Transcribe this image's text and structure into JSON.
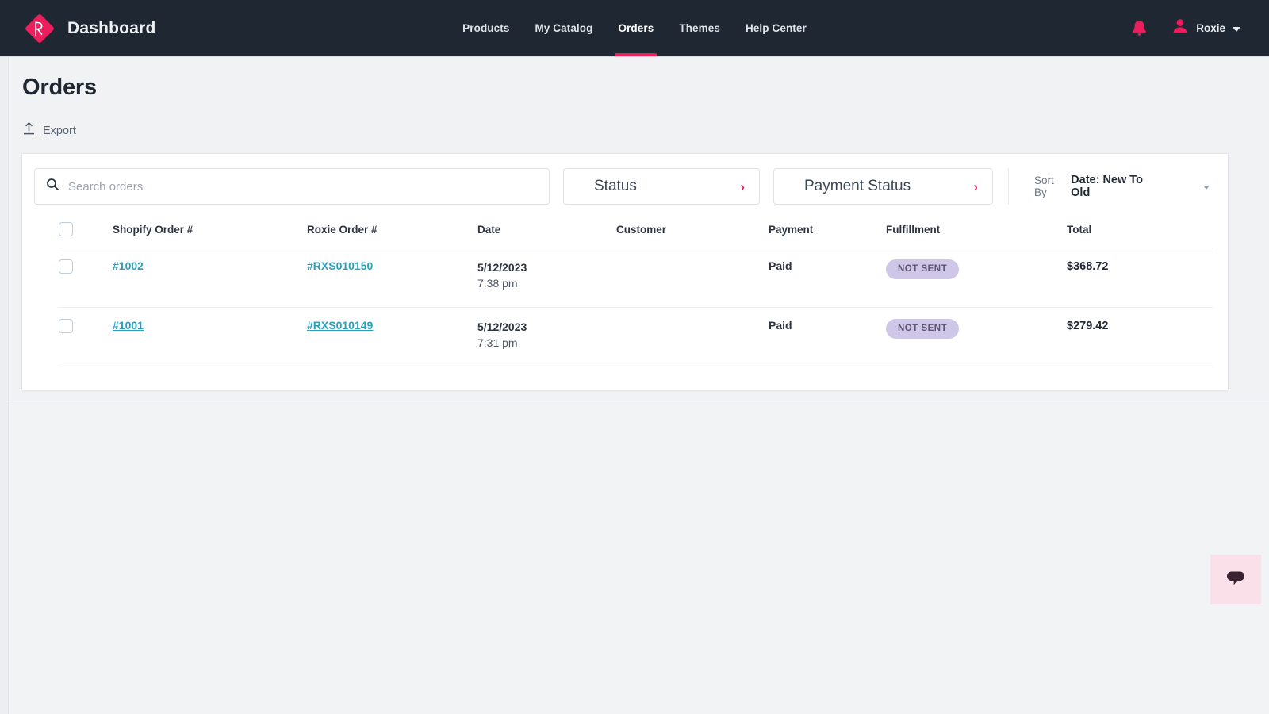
{
  "header": {
    "brand_title": "Dashboard",
    "logo_icon": "roxie-diamond-logo",
    "nav": [
      {
        "label": "Products",
        "active": false
      },
      {
        "label": "My Catalog",
        "active": false
      },
      {
        "label": "Orders",
        "active": true
      },
      {
        "label": "Themes",
        "active": false
      },
      {
        "label": "Help Center",
        "active": false
      }
    ],
    "notifications_icon": "bell-icon",
    "account_icon": "user-avatar-icon",
    "account_name": "Roxie",
    "account_caret": "chevron-down-icon",
    "accent_color": "#ec1e5e",
    "bar_color": "#1f2733"
  },
  "page": {
    "title": "Orders",
    "export_label": "Export",
    "export_icon": "upload-icon"
  },
  "filters": {
    "search": {
      "placeholder": "Search orders",
      "value": "",
      "icon": "search-icon"
    },
    "status_button": {
      "label": "Status",
      "icon": "chevron-right-icon"
    },
    "payment_button": {
      "label": "Payment Status",
      "icon": "chevron-right-icon"
    },
    "sort": {
      "label": "Sort By",
      "value": "Date: New To Old",
      "icon": "caret-down-icon",
      "options": [
        "Date: New To Old"
      ]
    }
  },
  "table": {
    "select_all_checked": false,
    "columns": [
      "Shopify Order #",
      "Roxie Order #",
      "Date",
      "Customer",
      "Payment",
      "Fulfillment",
      "Total"
    ],
    "rows": [
      {
        "selected": false,
        "shopify_order": "#1002",
        "roxie_order": "#RXS010150",
        "date": "5/12/2023",
        "time": "7:38 pm",
        "customer": "",
        "payment": "Paid",
        "fulfillment": "NOT SENT",
        "total": "$368.72"
      },
      {
        "selected": false,
        "shopify_order": "#1001",
        "roxie_order": "#RXS010149",
        "date": "5/12/2023",
        "time": "7:31 pm",
        "customer": "",
        "payment": "Paid",
        "fulfillment": "NOT SENT",
        "total": "$279.42"
      }
    ],
    "badge_bg": "#cfc7e8",
    "badge_text_color": "#5d5470",
    "link_color": "#2b9fbb"
  },
  "chat_widget": {
    "icon": "chat-bubble-icon",
    "bg_color": "#fae0e8"
  }
}
